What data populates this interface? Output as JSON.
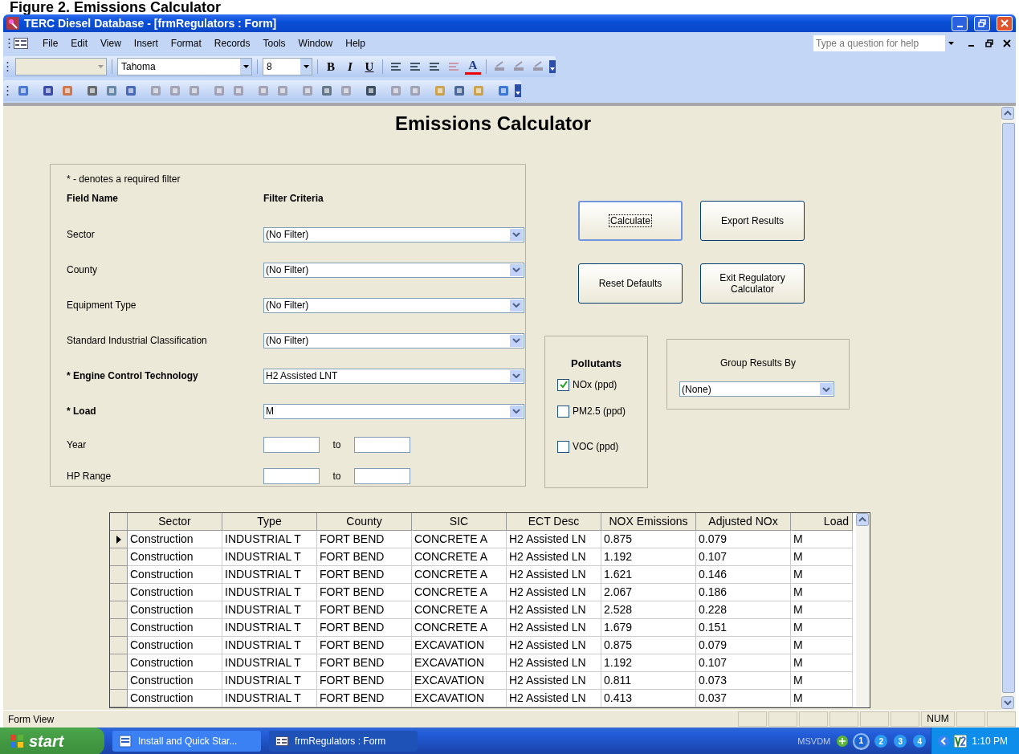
{
  "caption": "Figure 2. Emissions Calculator",
  "window": {
    "title": "TERC Diesel Database - [frmRegulators : Form]"
  },
  "menu": [
    "File",
    "Edit",
    "View",
    "Insert",
    "Format",
    "Records",
    "Tools",
    "Window",
    "Help"
  ],
  "help_box": {
    "placeholder": "Type a question for help"
  },
  "formatting_toolbar": {
    "font": "Tahoma",
    "size": "8",
    "style_buttons": [
      {
        "label": "B",
        "kind": "bold"
      },
      {
        "label": "I",
        "kind": "italic"
      },
      {
        "label": "U",
        "kind": "underline"
      }
    ],
    "font_color_glyph": "A"
  },
  "form": {
    "title": "Emissions Calculator",
    "filter_panel": {
      "note": "* - denotes a required filter",
      "headers": [
        "Field Name",
        "Filter Criteria"
      ],
      "rows": [
        {
          "kind": "dropdown",
          "label": "Sector",
          "value": "(No Filter)",
          "required": false
        },
        {
          "kind": "dropdown",
          "label": "County",
          "value": "(No Filter)",
          "required": false
        },
        {
          "kind": "dropdown",
          "label": "Equipment Type",
          "value": "(No Filter)",
          "required": false
        },
        {
          "kind": "dropdown",
          "label": "Standard Industrial Classification",
          "value": "(No Filter)",
          "required": false
        },
        {
          "kind": "dropdown",
          "label": "* Engine Control Technology",
          "value": "H2 Assisted LNT",
          "required": true
        },
        {
          "kind": "dropdown",
          "label": "* Load",
          "value": "M",
          "required": true
        },
        {
          "kind": "range",
          "label": "Year",
          "to": "to",
          "required": false
        },
        {
          "kind": "range",
          "label": "HP Range",
          "to": "to",
          "required": false
        }
      ]
    },
    "buttons": [
      {
        "label": "Calculate",
        "focused": true
      },
      {
        "label": "Export Results",
        "focused": false
      },
      {
        "label": "Reset Defaults",
        "focused": false
      },
      {
        "label": "Exit Regulatory Calculator",
        "focused": false
      }
    ],
    "pollutants": {
      "title": "Pollutants",
      "items": [
        {
          "label": "NOx (ppd)",
          "checked": true
        },
        {
          "label": "PM2.5 (ppd)",
          "checked": false
        },
        {
          "label": "VOC (ppd)",
          "checked": false
        }
      ]
    },
    "group_by": {
      "label": "Group Results By",
      "value": "(None)"
    }
  },
  "table": {
    "columns": [
      "Sector",
      "Type",
      "County",
      "SIC",
      "ECT Desc",
      "NOX Emissions",
      "Adjusted NOx",
      "Load"
    ],
    "rows": [
      {
        "selected": true,
        "cells": [
          "Construction",
          "INDUSTRIAL T",
          "FORT BEND",
          "CONCRETE A",
          "H2 Assisted LN",
          "0.875",
          "0.079",
          "M"
        ]
      },
      {
        "selected": false,
        "cells": [
          "Construction",
          "INDUSTRIAL T",
          "FORT BEND",
          "CONCRETE A",
          "H2 Assisted LN",
          "1.192",
          "0.107",
          "M"
        ]
      },
      {
        "selected": false,
        "cells": [
          "Construction",
          "INDUSTRIAL T",
          "FORT BEND",
          "CONCRETE A",
          "H2 Assisted LN",
          "1.621",
          "0.146",
          "M"
        ]
      },
      {
        "selected": false,
        "cells": [
          "Construction",
          "INDUSTRIAL T",
          "FORT BEND",
          "CONCRETE A",
          "H2 Assisted LN",
          "2.067",
          "0.186",
          "M"
        ]
      },
      {
        "selected": false,
        "cells": [
          "Construction",
          "INDUSTRIAL T",
          "FORT BEND",
          "CONCRETE A",
          "H2 Assisted LN",
          "2.528",
          "0.228",
          "M"
        ]
      },
      {
        "selected": false,
        "cells": [
          "Construction",
          "INDUSTRIAL T",
          "FORT BEND",
          "CONCRETE A",
          "H2 Assisted LN",
          "1.679",
          "0.151",
          "M"
        ]
      },
      {
        "selected": false,
        "cells": [
          "Construction",
          "INDUSTRIAL T",
          "FORT BEND",
          "EXCAVATION",
          "H2 Assisted LN",
          "0.875",
          "0.079",
          "M"
        ]
      },
      {
        "selected": false,
        "cells": [
          "Construction",
          "INDUSTRIAL T",
          "FORT BEND",
          "EXCAVATION",
          "H2 Assisted LN",
          "1.192",
          "0.107",
          "M"
        ]
      },
      {
        "selected": false,
        "cells": [
          "Construction",
          "INDUSTRIAL T",
          "FORT BEND",
          "EXCAVATION",
          "H2 Assisted LN",
          "0.811",
          "0.073",
          "M"
        ]
      },
      {
        "selected": false,
        "cells": [
          "Construction",
          "INDUSTRIAL T",
          "FORT BEND",
          "EXCAVATION",
          "H2 Assisted LN",
          "0.413",
          "0.037",
          "M"
        ]
      }
    ]
  },
  "status_bar": {
    "text": "Form View",
    "indicator": "NUM"
  },
  "taskbar": {
    "start": "start",
    "tasks": [
      {
        "label": "Install and Quick Star...",
        "active": false,
        "kind": "document"
      },
      {
        "label": "frmRegulators : Form",
        "active": true,
        "kind": "form"
      }
    ],
    "tray_label": "MSVDM",
    "desktops": [
      {
        "label": "1",
        "selected": true
      },
      {
        "label": "2",
        "selected": false
      },
      {
        "label": "3",
        "selected": false
      },
      {
        "label": "4",
        "selected": false
      }
    ],
    "time": "1:10 PM"
  }
}
